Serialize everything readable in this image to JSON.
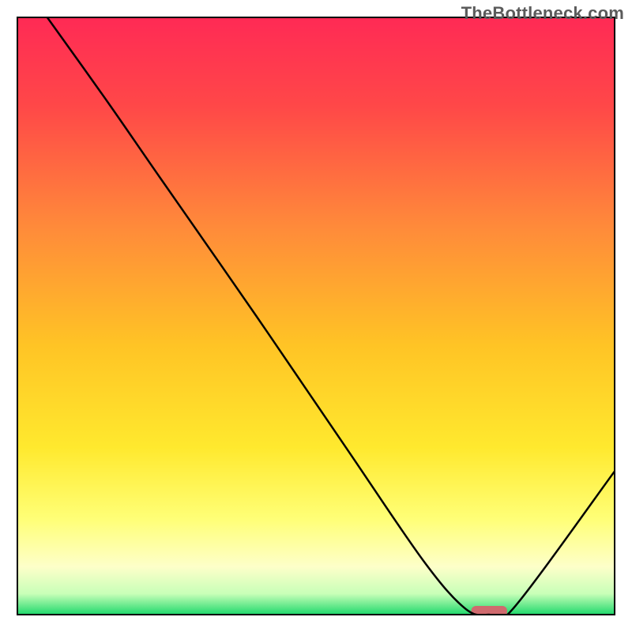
{
  "watermark": {
    "text": "TheBottleneck.com"
  },
  "chart_data": {
    "type": "line",
    "title": "",
    "xlabel": "",
    "ylabel": "",
    "xlim": [
      0,
      100
    ],
    "ylim": [
      0,
      100
    ],
    "grid": false,
    "legend": null,
    "series": [
      {
        "name": "bottleneck-curve",
        "x": [
          5,
          15,
          24,
          40,
          55,
          68,
          75,
          79,
          83,
          100
        ],
        "y": [
          100,
          86,
          73,
          50,
          28,
          9,
          1,
          0,
          1,
          24
        ]
      }
    ],
    "marker": {
      "name": "optimal-marker",
      "x": 79,
      "y": 0,
      "width": 6,
      "color": "#cf6a6e"
    },
    "background_gradient": {
      "stops": [
        {
          "offset": 0.0,
          "color": "#ff2a55"
        },
        {
          "offset": 0.15,
          "color": "#ff4848"
        },
        {
          "offset": 0.35,
          "color": "#ff8a3a"
        },
        {
          "offset": 0.55,
          "color": "#ffc425"
        },
        {
          "offset": 0.72,
          "color": "#ffe92e"
        },
        {
          "offset": 0.84,
          "color": "#ffff77"
        },
        {
          "offset": 0.92,
          "color": "#fdffc9"
        },
        {
          "offset": 0.965,
          "color": "#c8ffb8"
        },
        {
          "offset": 1.0,
          "color": "#1fd96c"
        }
      ]
    },
    "frame": {
      "inset": 22,
      "stroke": "#000000",
      "stroke_width": 2
    }
  }
}
